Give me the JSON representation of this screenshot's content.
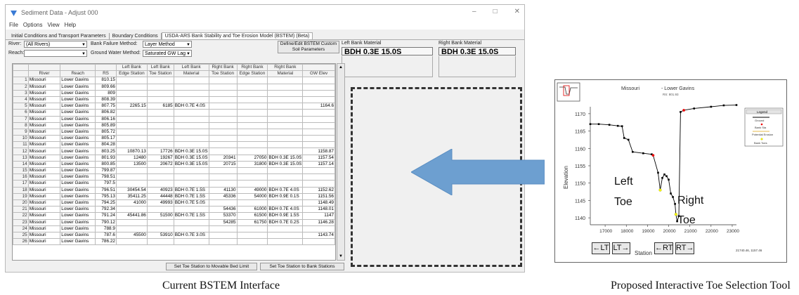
{
  "window": {
    "title": "Sediment Data - Adjust 000",
    "menu": [
      "File",
      "Options",
      "View",
      "Help"
    ],
    "controls": [
      "–",
      "□",
      "✕"
    ]
  },
  "tabs": [
    "Initial Conditions and Transport Parameters",
    "Boundary Conditions",
    "USDA-ARS Bank Stability and Toe Erosion Model (BSTEM) (Beta)"
  ],
  "controls": {
    "river_label": "River:",
    "river_value": "(All Rivers)",
    "reach_label": "Reach:",
    "reach_value": "",
    "bank_failure_label": "Bank Failure Method:",
    "bank_failure_value": "Layer Method",
    "gw_label": "Ground Water Method:",
    "gw_value": "Saturated GW Lag",
    "define_btn": "Define/Edit BSTEM Custom Soil Parameters",
    "left_mat_label": "Left Bank Material",
    "left_mat_value": "BDH 0.3E 15.0S",
    "right_mat_label": "Right Bank Material",
    "right_mat_value": "BDH 0.3E 15.0S"
  },
  "grid": {
    "headers_top": [
      "",
      "",
      "",
      "",
      "Left Bank",
      "Left Bank",
      "Left Bank",
      "Right Bank",
      "Right Bank",
      "Right Bank",
      ""
    ],
    "headers_bottom": [
      "",
      "River",
      "Reach",
      "RS",
      "Edge Station",
      "Toe Station",
      "Material",
      "Toe Station",
      "Edge Station",
      "Material",
      "GW Elev"
    ],
    "rows": [
      [
        "1",
        "Missouri",
        "Lower Gavins",
        "810.15",
        "",
        "",
        "",
        "",
        "",
        "",
        ""
      ],
      [
        "2",
        "Missouri",
        "Lower Gavins",
        "809.66",
        "",
        "",
        "",
        "",
        "",
        "",
        ""
      ],
      [
        "3",
        "Missouri",
        "Lower Gavins",
        "809",
        "",
        "",
        "",
        "",
        "",
        "",
        ""
      ],
      [
        "4",
        "Missouri",
        "Lower Gavins",
        "808.39",
        "",
        "",
        "",
        "",
        "",
        "",
        ""
      ],
      [
        "5",
        "Missouri",
        "Lower Gavins",
        "807.75",
        "2265.15",
        "6185",
        "BDH 0.7E 4.0S",
        "",
        "",
        "",
        "1164.6"
      ],
      [
        "6",
        "Missouri",
        "Lower Gavins",
        "806.82",
        "",
        "",
        "",
        "",
        "",
        "",
        ""
      ],
      [
        "7",
        "Missouri",
        "Lower Gavins",
        "806.16",
        "",
        "",
        "",
        "",
        "",
        "",
        ""
      ],
      [
        "8",
        "Missouri",
        "Lower Gavins",
        "805.89",
        "",
        "",
        "",
        "",
        "",
        "",
        ""
      ],
      [
        "9",
        "Missouri",
        "Lower Gavins",
        "805.72",
        "",
        "",
        "",
        "",
        "",
        "",
        ""
      ],
      [
        "10",
        "Missouri",
        "Lower Gavins",
        "805.17",
        "",
        "",
        "",
        "",
        "",
        "",
        ""
      ],
      [
        "11",
        "Missouri",
        "Lower Gavins",
        "804.28",
        "",
        "",
        "",
        "",
        "",
        "",
        ""
      ],
      [
        "12",
        "Missouri",
        "Lower Gavins",
        "803.25",
        "10870.13",
        "17726",
        "BDH 0.3E 15.0S",
        "",
        "",
        "",
        "1158.87"
      ],
      [
        "13",
        "Missouri",
        "Lower Gavins",
        "801.93",
        "12480",
        "19267",
        "BDH 0.3E 15.0S",
        "20341",
        "27050",
        "BDH 0.3E 15.0S",
        "1157.54"
      ],
      [
        "14",
        "Missouri",
        "Lower Gavins",
        "800.85",
        "13500",
        "20672",
        "BDH 0.3E 15.0S",
        "20715",
        "31800",
        "BDH 0.3E 15.0S",
        "1157.14"
      ],
      [
        "15",
        "Missouri",
        "Lower Gavins",
        "799.87",
        "",
        "",
        "",
        "",
        "",
        "",
        ""
      ],
      [
        "16",
        "Missouri",
        "Lower Gavins",
        "798.51",
        "",
        "",
        "",
        "",
        "",
        "",
        ""
      ],
      [
        "17",
        "Missouri",
        "Lower Gavins",
        "797.5",
        "",
        "",
        "",
        "",
        "",
        "",
        ""
      ],
      [
        "18",
        "Missouri",
        "Lower Gavins",
        "796.51",
        "30454.54",
        "40923",
        "BDH 0.7E 1.5S",
        "41130",
        "49000",
        "BDH 0.7E 4.0S",
        "1152.62"
      ],
      [
        "19",
        "Missouri",
        "Lower Gavins",
        "795.13",
        "35411.25",
        "44448",
        "BDH 0.7E 1.5S",
        "45336",
        "54000",
        "BDH 0.9E 0.1S",
        "1151.56"
      ],
      [
        "20",
        "Missouri",
        "Lower Gavins",
        "794.25",
        "41000",
        "49993",
        "BDH 0.7E 5.0S",
        "",
        "",
        "",
        "1148.49"
      ],
      [
        "21",
        "Missouri",
        "Lower Gavins",
        "792.34",
        "",
        "",
        "",
        "54436",
        "61000",
        "BDH 0.7E 4.0S",
        "1148.01"
      ],
      [
        "22",
        "Missouri",
        "Lower Gavins",
        "791.24",
        "45441.86",
        "51500",
        "BDH 0.7E 1.5S",
        "53370",
        "61500",
        "BDH 0.9E 1.5S",
        "1147"
      ],
      [
        "23",
        "Missouri",
        "Lower Gavins",
        "790.12",
        "",
        "",
        "",
        "54285",
        "61750",
        "BDH 0.7E 0.2S",
        "1146.28"
      ],
      [
        "24",
        "Missouri",
        "Lower Gavins",
        "788.9",
        "",
        "",
        "",
        "",
        "",
        "",
        ""
      ],
      [
        "25",
        "Missouri",
        "Lower Gavins",
        "787.6",
        "45500",
        "53910",
        "BDH 0.7E 3.0S",
        "",
        "",
        "",
        "1143.74"
      ],
      [
        "26",
        "Missouri",
        "Lower Gavins",
        "786.22",
        "",
        "",
        "",
        "",
        "",
        "",
        ""
      ]
    ]
  },
  "bottom_buttons": [
    "Set Toe Station to Movable Bed Limit",
    "Set Toe Station to Bank Stations"
  ],
  "captions": {
    "left": "Current BSTEM Interface",
    "right": "Proposed Interactive Toe Selection Tool"
  },
  "plot": {
    "title_river": "Missouri",
    "title_reach": "- Lower Gavins",
    "rs": "RS: 801.93",
    "ylabel": "Elevation",
    "xlabel": "Station",
    "legend_title": "Legend",
    "legend": [
      "Ground",
      "Bank Sta",
      "Potential Erosion",
      "Bank Toes"
    ],
    "left_label_1": "Left",
    "left_label_2": "Toe",
    "right_label_1": "Right",
    "right_label_2": "Toe",
    "nav": [
      "←LT",
      "LT→",
      "←RT",
      "RT→"
    ],
    "readout": "21740.46, 1157.46",
    "yticks": [
      "1170",
      "1165",
      "1160",
      "1155",
      "1150",
      "1145",
      "1140"
    ],
    "xticks": [
      "17000",
      "18000",
      "19000",
      "20000",
      "21000",
      "22000",
      "23000"
    ]
  },
  "chart_data": {
    "type": "line",
    "title": "Missouri - Lower Gavins",
    "xlabel": "Station",
    "ylabel": "Elevation",
    "xlim": [
      16300,
      23200
    ],
    "ylim": [
      1138,
      1172
    ],
    "series": [
      {
        "name": "Ground",
        "values": [
          [
            16300,
            1167
          ],
          [
            16700,
            1167
          ],
          [
            17200,
            1166.8
          ],
          [
            17600,
            1166.5
          ],
          [
            17800,
            1166.4
          ],
          [
            17900,
            1163
          ],
          [
            18100,
            1162.5
          ],
          [
            18300,
            1159
          ],
          [
            18800,
            1158.6
          ],
          [
            19200,
            1158.3
          ],
          [
            19267,
            1158
          ],
          [
            19500,
            1153
          ],
          [
            19600,
            1148
          ],
          [
            19700,
            1151.5
          ],
          [
            19800,
            1152.5
          ],
          [
            19900,
            1152
          ],
          [
            20000,
            1151
          ],
          [
            20100,
            1147
          ],
          [
            20200,
            1146
          ],
          [
            20300,
            1144
          ],
          [
            20341,
            1141
          ],
          [
            20400,
            1139
          ],
          [
            20480,
            1140.5
          ],
          [
            20560,
            1170.5
          ],
          [
            20715,
            1171
          ],
          [
            21200,
            1171.5
          ],
          [
            22000,
            1172
          ],
          [
            22600,
            1172.4
          ],
          [
            23200,
            1172.5
          ]
        ]
      }
    ],
    "bank_stations": [
      [
        19267,
        1158
      ],
      [
        20715,
        1171
      ]
    ],
    "bank_toes": [
      [
        19600,
        1148
      ],
      [
        20341,
        1141
      ]
    ]
  }
}
